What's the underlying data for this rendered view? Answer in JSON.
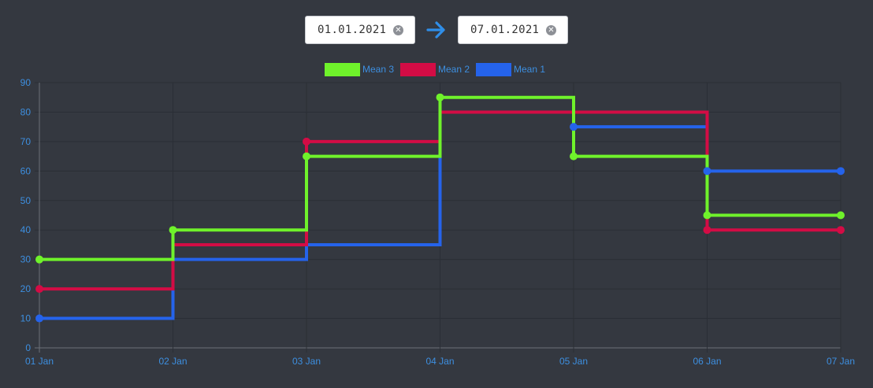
{
  "date_range": {
    "start": "01.01.2021",
    "end": "07.01.2021",
    "clear_icon": "clear-circle-icon",
    "arrow_icon": "arrow-right-icon",
    "arrow_color": "#2f8ee8"
  },
  "chart_data": {
    "type": "line",
    "step": "before",
    "categories": [
      "01 Jan",
      "02 Jan",
      "03 Jan",
      "04 Jan",
      "05 Jan",
      "06 Jan",
      "07 Jan"
    ],
    "ylim": [
      0,
      90
    ],
    "yticks": [
      0,
      10,
      20,
      30,
      40,
      50,
      60,
      70,
      80,
      90
    ],
    "grid": true,
    "legend_position": "top-center",
    "series": [
      {
        "name": "Mean 1",
        "color": "#2563eb",
        "values": [
          10,
          30,
          35,
          80,
          75,
          60,
          60
        ]
      },
      {
        "name": "Mean 2",
        "color": "#d30c45",
        "values": [
          20,
          35,
          70,
          80,
          80,
          40,
          40
        ]
      },
      {
        "name": "Mean 3",
        "color": "#6ff22b",
        "values": [
          30,
          40,
          65,
          85,
          65,
          45,
          45
        ]
      }
    ],
    "legend_order": [
      "Mean 3",
      "Mean 2",
      "Mean 1"
    ],
    "markers": {
      "Mean 1": [
        0,
        4,
        5,
        6
      ],
      "Mean 2": [
        0,
        2,
        5,
        6
      ],
      "Mean 3": [
        0,
        1,
        2,
        3,
        4,
        5,
        6
      ]
    }
  }
}
